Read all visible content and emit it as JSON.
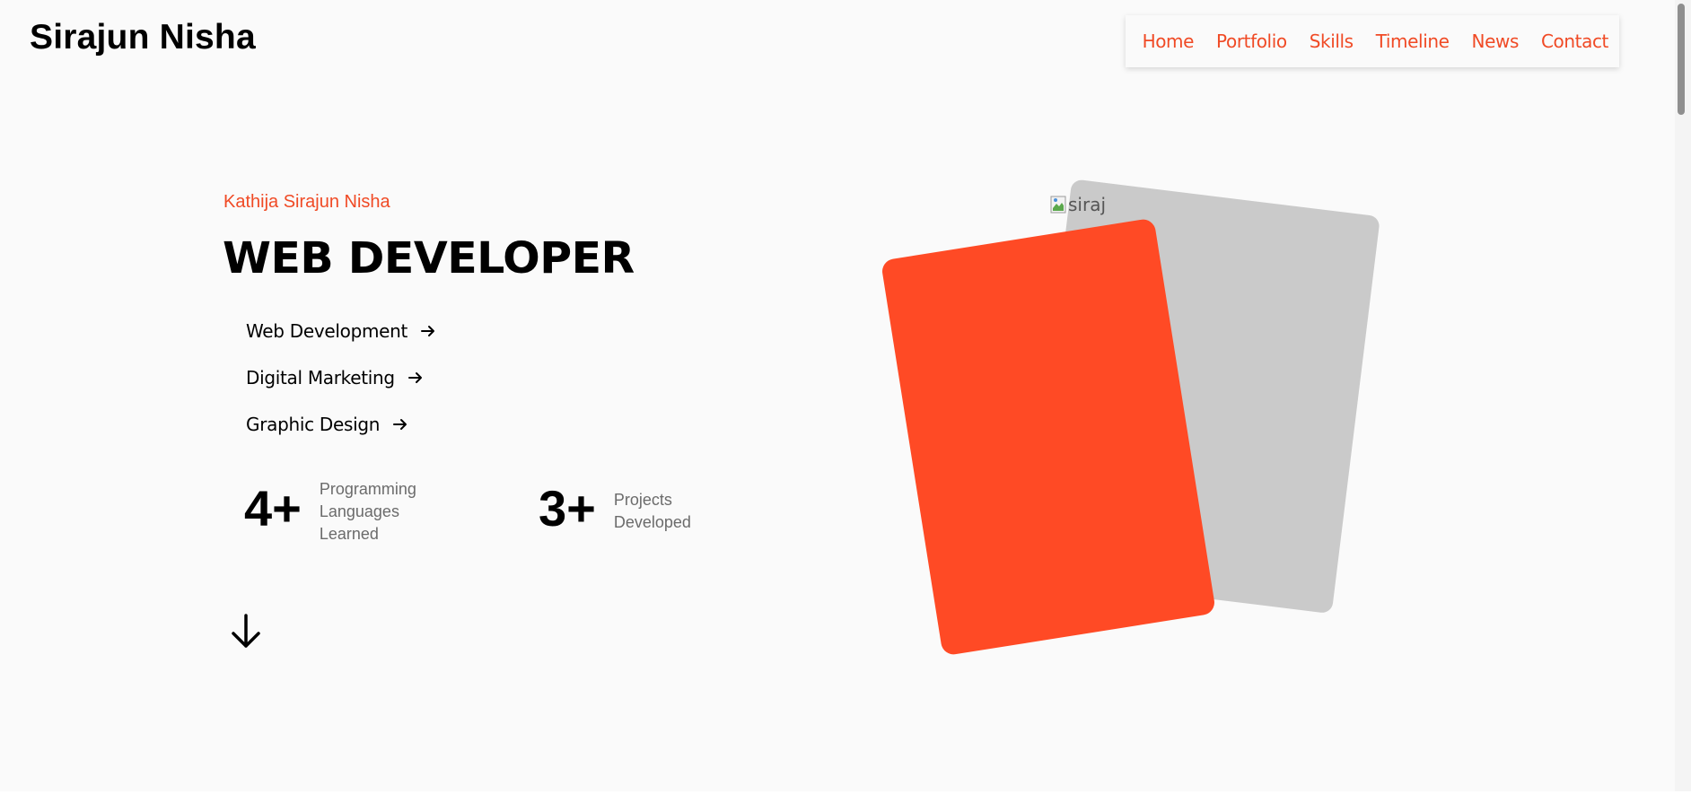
{
  "header": {
    "site_title": "Sirajun Nisha"
  },
  "nav": {
    "items": [
      "Home",
      "Portfolio",
      "Skills",
      "Timeline",
      "News",
      "Contact"
    ]
  },
  "hero": {
    "eyebrow": "Kathija Sirajun Nisha",
    "headline": "WEB DEVELOPER",
    "services": [
      "Web Development",
      "Digital Marketing",
      "Graphic Design"
    ],
    "stats": [
      {
        "number": "4+",
        "label": "Programming Languages Learned"
      },
      {
        "number": "3+",
        "label": "Projects Developed"
      }
    ],
    "image_alt": "siraj"
  },
  "colors": {
    "accent": "#f04a25",
    "card_front": "#ff4a25",
    "card_back": "#cacaca"
  },
  "icons": {
    "service_arrow": "arrow-right-icon",
    "scroll_down": "arrow-down-icon",
    "broken_image": "broken-image-icon"
  }
}
